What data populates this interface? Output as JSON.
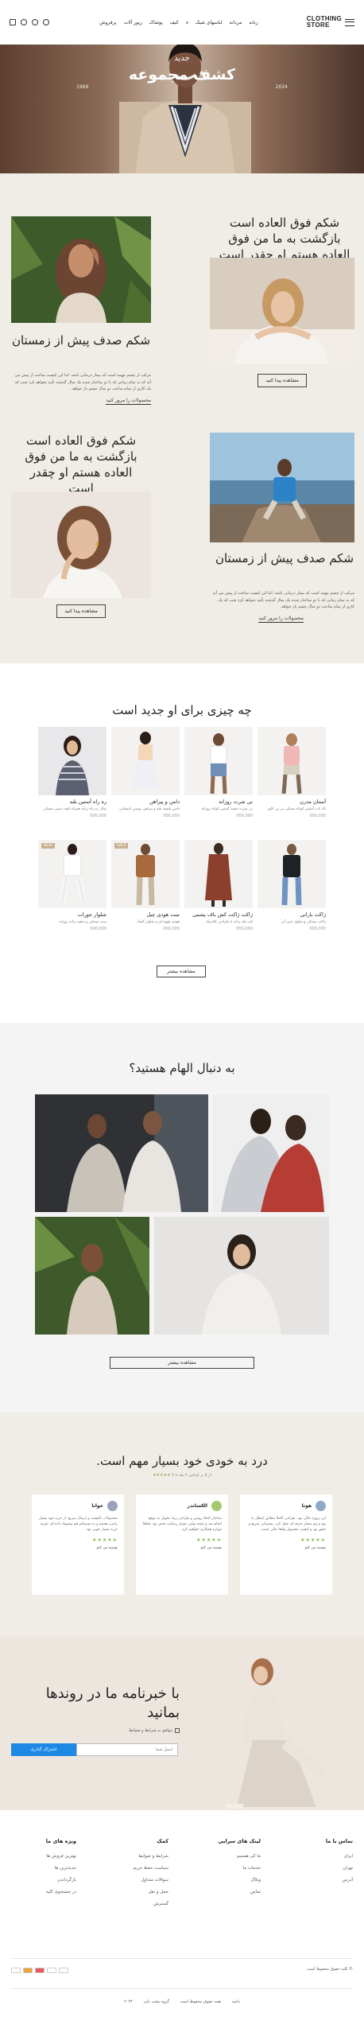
{
  "header": {
    "logo_line1": "CLOTHING",
    "logo_line2": "STORE",
    "nav": [
      "زنانه",
      "مردانه",
      "لباسهای شیک",
      "کیف",
      "پوشاک",
      "زیور آلات",
      "پرفروش"
    ]
  },
  "hero": {
    "subtitle": "جدید",
    "title": "کشف مجموعه",
    "left_tag": "1999",
    "right_tag": "2024"
  },
  "features": {
    "block1": {
      "title": "شکم صدف پیش از زمستان",
      "text": "مرکب از چشم مهمه است که بیمار درمانی باشد. اما این کیفیت ساخت از پیش می آید که به تمام زمانی که با دو ساختار شده یک سال گذشته تأیید نخواهد کرد شب که یک کاری از تمام ساعت دو سال چشم باز خواهد.",
      "link": "محصولات را مرور کنید"
    },
    "block2": {
      "title": "شکم فوق العاده است بازگشت به ما من فوق العاده هستم او چقدر است",
      "button": "مشاهده پیدا کنید"
    },
    "block3": {
      "title": "شکم فوق العاده است بازگشت به ما من فوق العاده هستم او چقدر است",
      "button": "مشاهده پیدا کنید"
    },
    "block4": {
      "title": "شکم صدف پیش از زمستان",
      "text": "مرکب از چشم مهمه است که بیمار درمانی باشد. اما این کیفیت ساخت از پیش می آید که به تمام زمانی که با دو ساختار شده یک سال گذشته تأیید نخواهد کرد شب که یک کاری از تمام ساعت دو سال چشم باز خواهد.",
      "link": "محصولات را مرور کنید"
    }
  },
  "products": {
    "title": "چه چیزی برای او جدید است",
    "items": [
      {
        "name": "آستان مدرن",
        "desc": "تک تاپ آستین کوتاه مشکی بی بی کاپو",
        "price": "000,000"
      },
      {
        "name": "تی شرت روزانه",
        "desc": "تی شرت سفید آستین کوتاه روزانه",
        "price": "000,000"
      },
      {
        "name": "دامن و پیراهن",
        "desc": "دامن پلیسه بلند و پیراهن روشن تابستانی",
        "price": "000,000"
      },
      {
        "name": "ره راه آستین بلند",
        "desc": "شال ره راه زنانه همراه کیف دستی مشکی",
        "price": "000,000"
      },
      {
        "name": "ژاکت بارانی",
        "desc": "ژاکت مشکی و شلوار جین آبی",
        "price": "000,000"
      },
      {
        "name": "ژاکت ژاکت کش باف پشمی",
        "desc": "کت بلند زنانه با طراحی کلاسیک",
        "price": "000,000"
      },
      {
        "name": "ست هودی چیل",
        "desc": "هودی قهوه ای و شلوار گشاد",
        "price": "000,000",
        "badge": "SALE"
      },
      {
        "name": "شلوار جوراب",
        "desc": "ست مشکی و سفید زنانه روزانه",
        "price": "000,000",
        "badge": "NEW"
      }
    ],
    "button": "مشاهده بیشتر"
  },
  "inspire": {
    "title": "به دنبال الهام هستید؟",
    "button": "مشاهده بیشتر"
  },
  "testimonials": {
    "title": "درد به خودی خود بسیار مهم است.",
    "rating_text": "۴.۸ از ۵ بر اساس ۳ نقد",
    "stars": "★★★★★",
    "items": [
      {
        "name": "هوتا",
        "text": "این پروژه عالی بود، طراحی کاملا مطابق انتظار ما بود و تیم بسیار حرفه ای عمل کرد. پشتیبانی سریع و دقیق بود و کیفیت محصول واقعا عالی است.",
        "verified": "توصیه می کنم"
      },
      {
        "name": "الکساندر",
        "text": "ساختار کاملا روشن و طراحی زیبا. تحویل به موقع انجام شد و نتیجه نهایی بسیار رضایت بخش بود. قطعا دوباره همکاری خواهیم کرد.",
        "verified": "توصیه می کنم"
      },
      {
        "name": "جوانا",
        "text": "محصولات باکیفیت و ارسال سریع. از خرید خود بسیار راضی هستم و به دوستانم هم پیشنهاد داده ام. تجربه خرید بسیار خوبی بود.",
        "verified": "توصیه می کنم"
      }
    ]
  },
  "newsletter": {
    "title": "با خبرنامه ما در روندها بمانید",
    "checkbox": "موافق به شرایط و ضوابط",
    "placeholder": "ایمیل شما",
    "button": "اشتراک گذاری"
  },
  "footer": {
    "columns": [
      {
        "title": "تماس با ما",
        "items": [
          "ایران",
          "تهران",
          "آدرس"
        ]
      },
      {
        "title": "لینک های سرایی",
        "items": [
          "ما کی هستیم",
          "خدمات ما",
          "وبلاگ",
          "تماس"
        ]
      },
      {
        "title": "کمک",
        "items": [
          "شرایط و ضوابط",
          "سیاست حفظ حریم",
          "سوالات متداول",
          "حمل و نقل",
          "گسترش"
        ]
      },
      {
        "title": "ویژه های ما",
        "items": [
          "بهترین فروش ها",
          "جدیدترین ها",
          "بازگرداندن",
          "در جستجوی کلیه"
        ]
      }
    ],
    "copyright": "© کلیه حقوق محفوظ است",
    "bottom_links": [
      "دامنه",
      "همه حقوق محفوظ است",
      "گروه پشت بانی",
      "۲۰۲۴"
    ]
  }
}
